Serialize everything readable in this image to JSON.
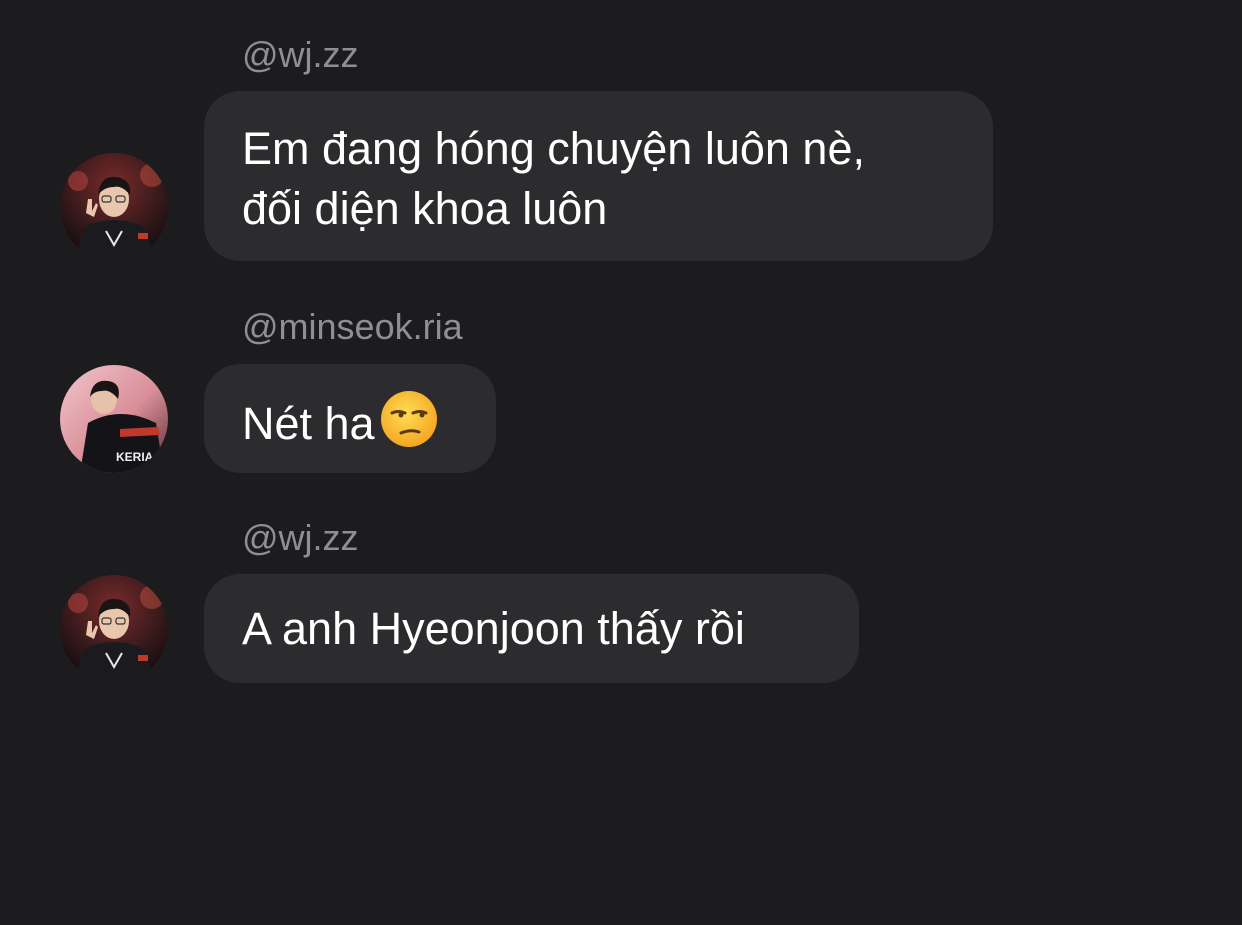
{
  "messages": [
    {
      "sender": "@wj.zz",
      "avatar_icon": "avatar-wjzz",
      "lines": [
        "Em đang hóng chuyện luôn nè,",
        "đối diện khoa luôn"
      ]
    },
    {
      "sender": "@minseok.ria",
      "avatar_icon": "avatar-minseok",
      "lines": [
        "Nét ha"
      ],
      "emoji": "unamused-face-icon"
    },
    {
      "sender": "@wj.zz",
      "avatar_icon": "avatar-wjzz",
      "lines": [
        "A anh Hyeonjoon thấy rồi"
      ]
    }
  ],
  "colors": {
    "background": "#1c1c1e",
    "bubble": "#2c2c2e",
    "sender_text": "#8e8e93",
    "message_text": "#ffffff"
  },
  "avatar_photo_text": "KERIA"
}
